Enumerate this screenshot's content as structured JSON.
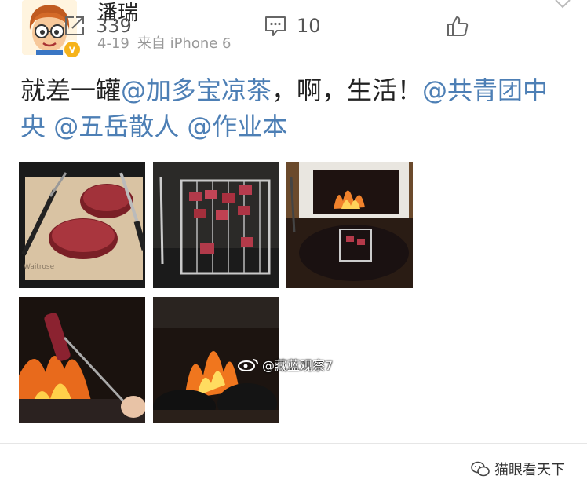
{
  "post": {
    "author": "潘瑞",
    "time": "4-19",
    "source": "来自 iPhone 6",
    "text_segments": [
      {
        "text": "就差一罐",
        "type": "plain"
      },
      {
        "text": "@加多宝凉茶",
        "type": "mention"
      },
      {
        "text": "，啊，生活！",
        "type": "plain"
      },
      {
        "text": "@共青团中央",
        "type": "mention"
      },
      {
        "text": " ",
        "type": "plain"
      },
      {
        "text": "@五岳散人",
        "type": "mention"
      },
      {
        "text": " ",
        "type": "plain"
      },
      {
        "text": "@作业本",
        "type": "mention"
      }
    ],
    "badge_glyph": "v",
    "photo_watermark": "@藏蓝观察7"
  },
  "images": [
    {
      "subject": "raw-steak-on-cutting-board",
      "caption": "Waitrose"
    },
    {
      "subject": "meat-skewers-on-grill-rack"
    },
    {
      "subject": "fireplace-with-grill"
    },
    {
      "subject": "skewer-over-fire"
    },
    {
      "subject": "fireplace-flames"
    }
  ],
  "actions": {
    "repost_count": "339",
    "comment_count": "10"
  },
  "corner_label": "猫眼看天下",
  "icons": [
    "chevron-down-icon",
    "repost-icon",
    "comment-icon",
    "like-icon",
    "weibo-logo-icon",
    "wechat-icon"
  ],
  "colors": {
    "mention": "#4d7fb5",
    "badge": "#f6b31b",
    "meta": "#999999"
  }
}
